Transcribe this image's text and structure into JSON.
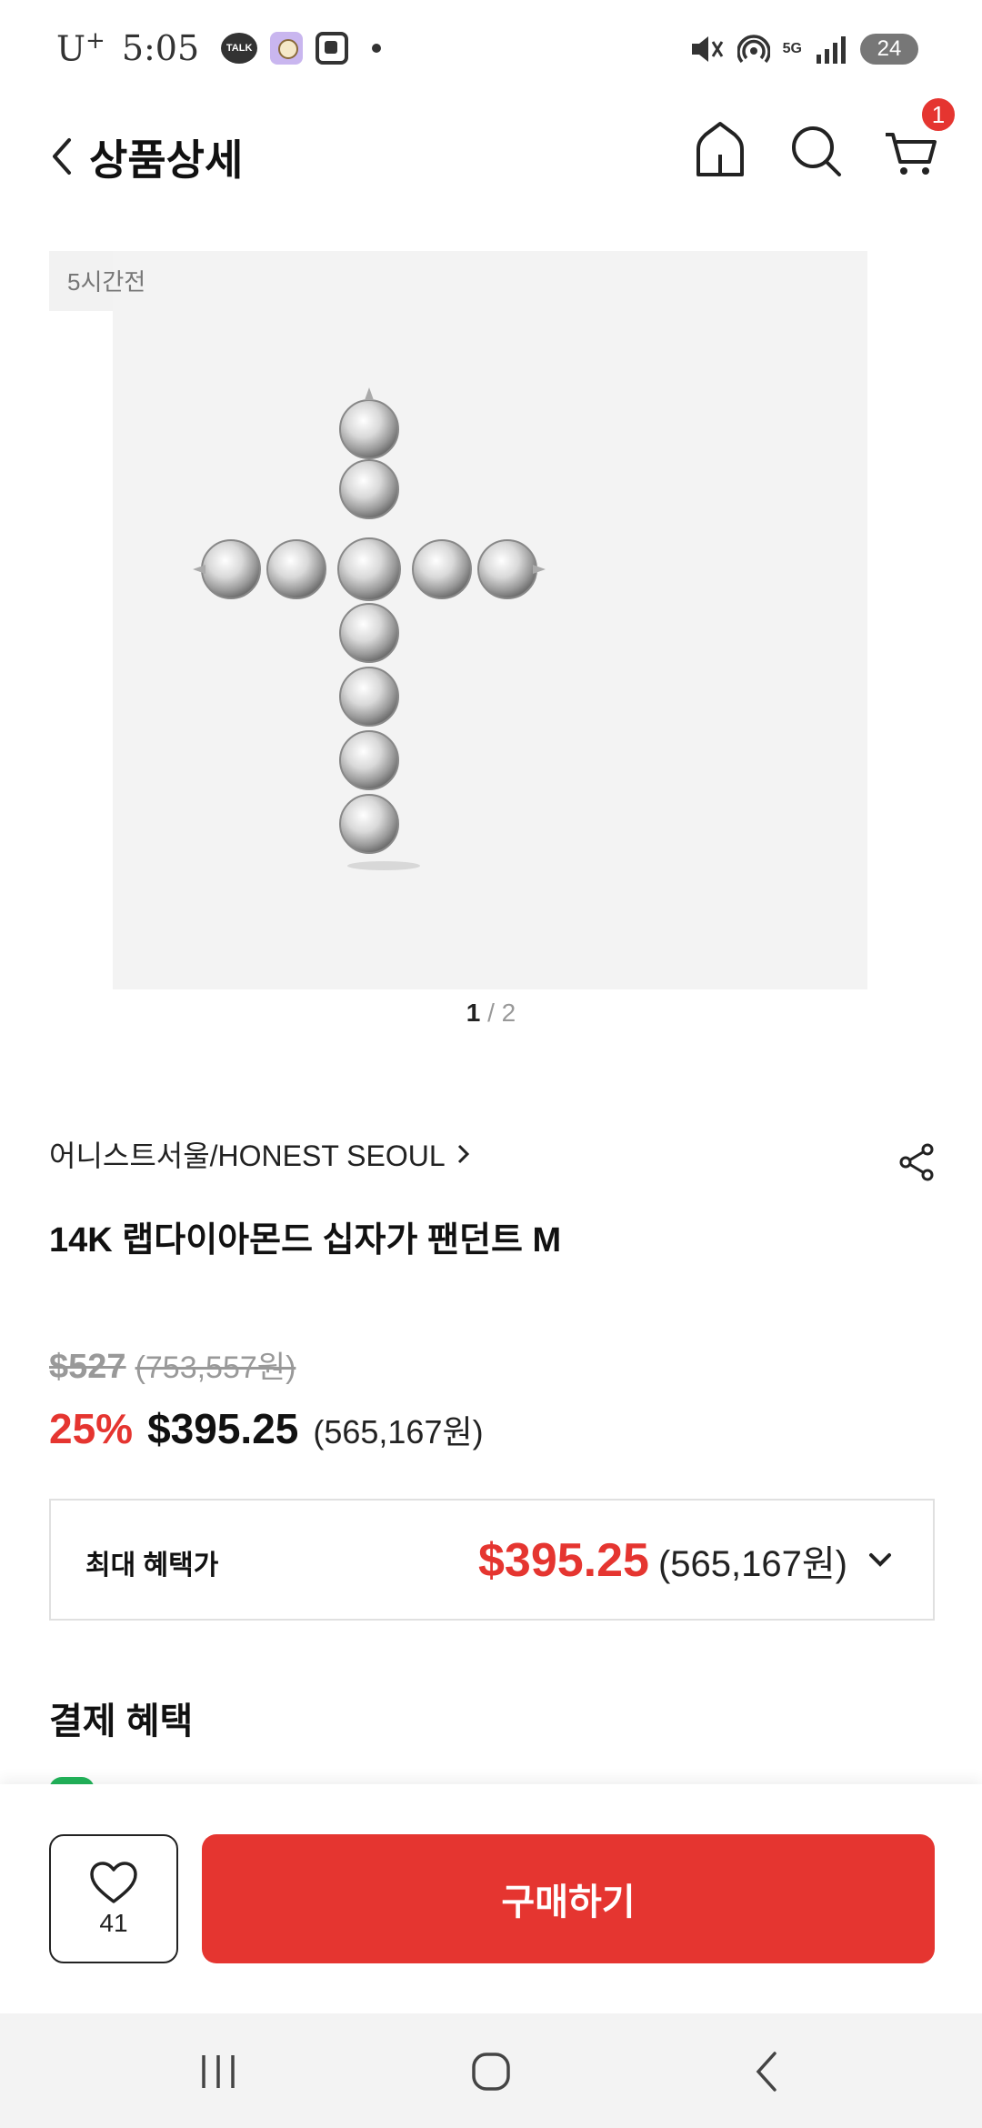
{
  "status_bar": {
    "carrier": "U",
    "carrier_sup": "+",
    "time": "5:05",
    "talk_label": "TALK",
    "network": "5G",
    "battery": "24"
  },
  "header": {
    "title": "상품상세",
    "cart_count": "1"
  },
  "gallery": {
    "time_ago": "5시간전",
    "current_page": "1",
    "separator": " / ",
    "total_pages": "2"
  },
  "product": {
    "brand": "어니스트서울/HONEST SEOUL",
    "title": "14K 랩다이아몬드 십자가 팬던트 M",
    "original_price_usd": "$527",
    "original_price_krw": "(753,557원)",
    "discount": "25%",
    "sale_price_usd": "$395.25",
    "sale_price_krw": "(565,167원)"
  },
  "benefit": {
    "label": "최대 혜택가",
    "price_usd": "$395.25",
    "price_krw": "(565,167원)"
  },
  "payment": {
    "heading": "결제 혜택"
  },
  "actions": {
    "wish_count": "41",
    "buy_label": "구매하기"
  },
  "colors": {
    "accent": "#e53530",
    "image_bg": "#f3f3f3"
  }
}
